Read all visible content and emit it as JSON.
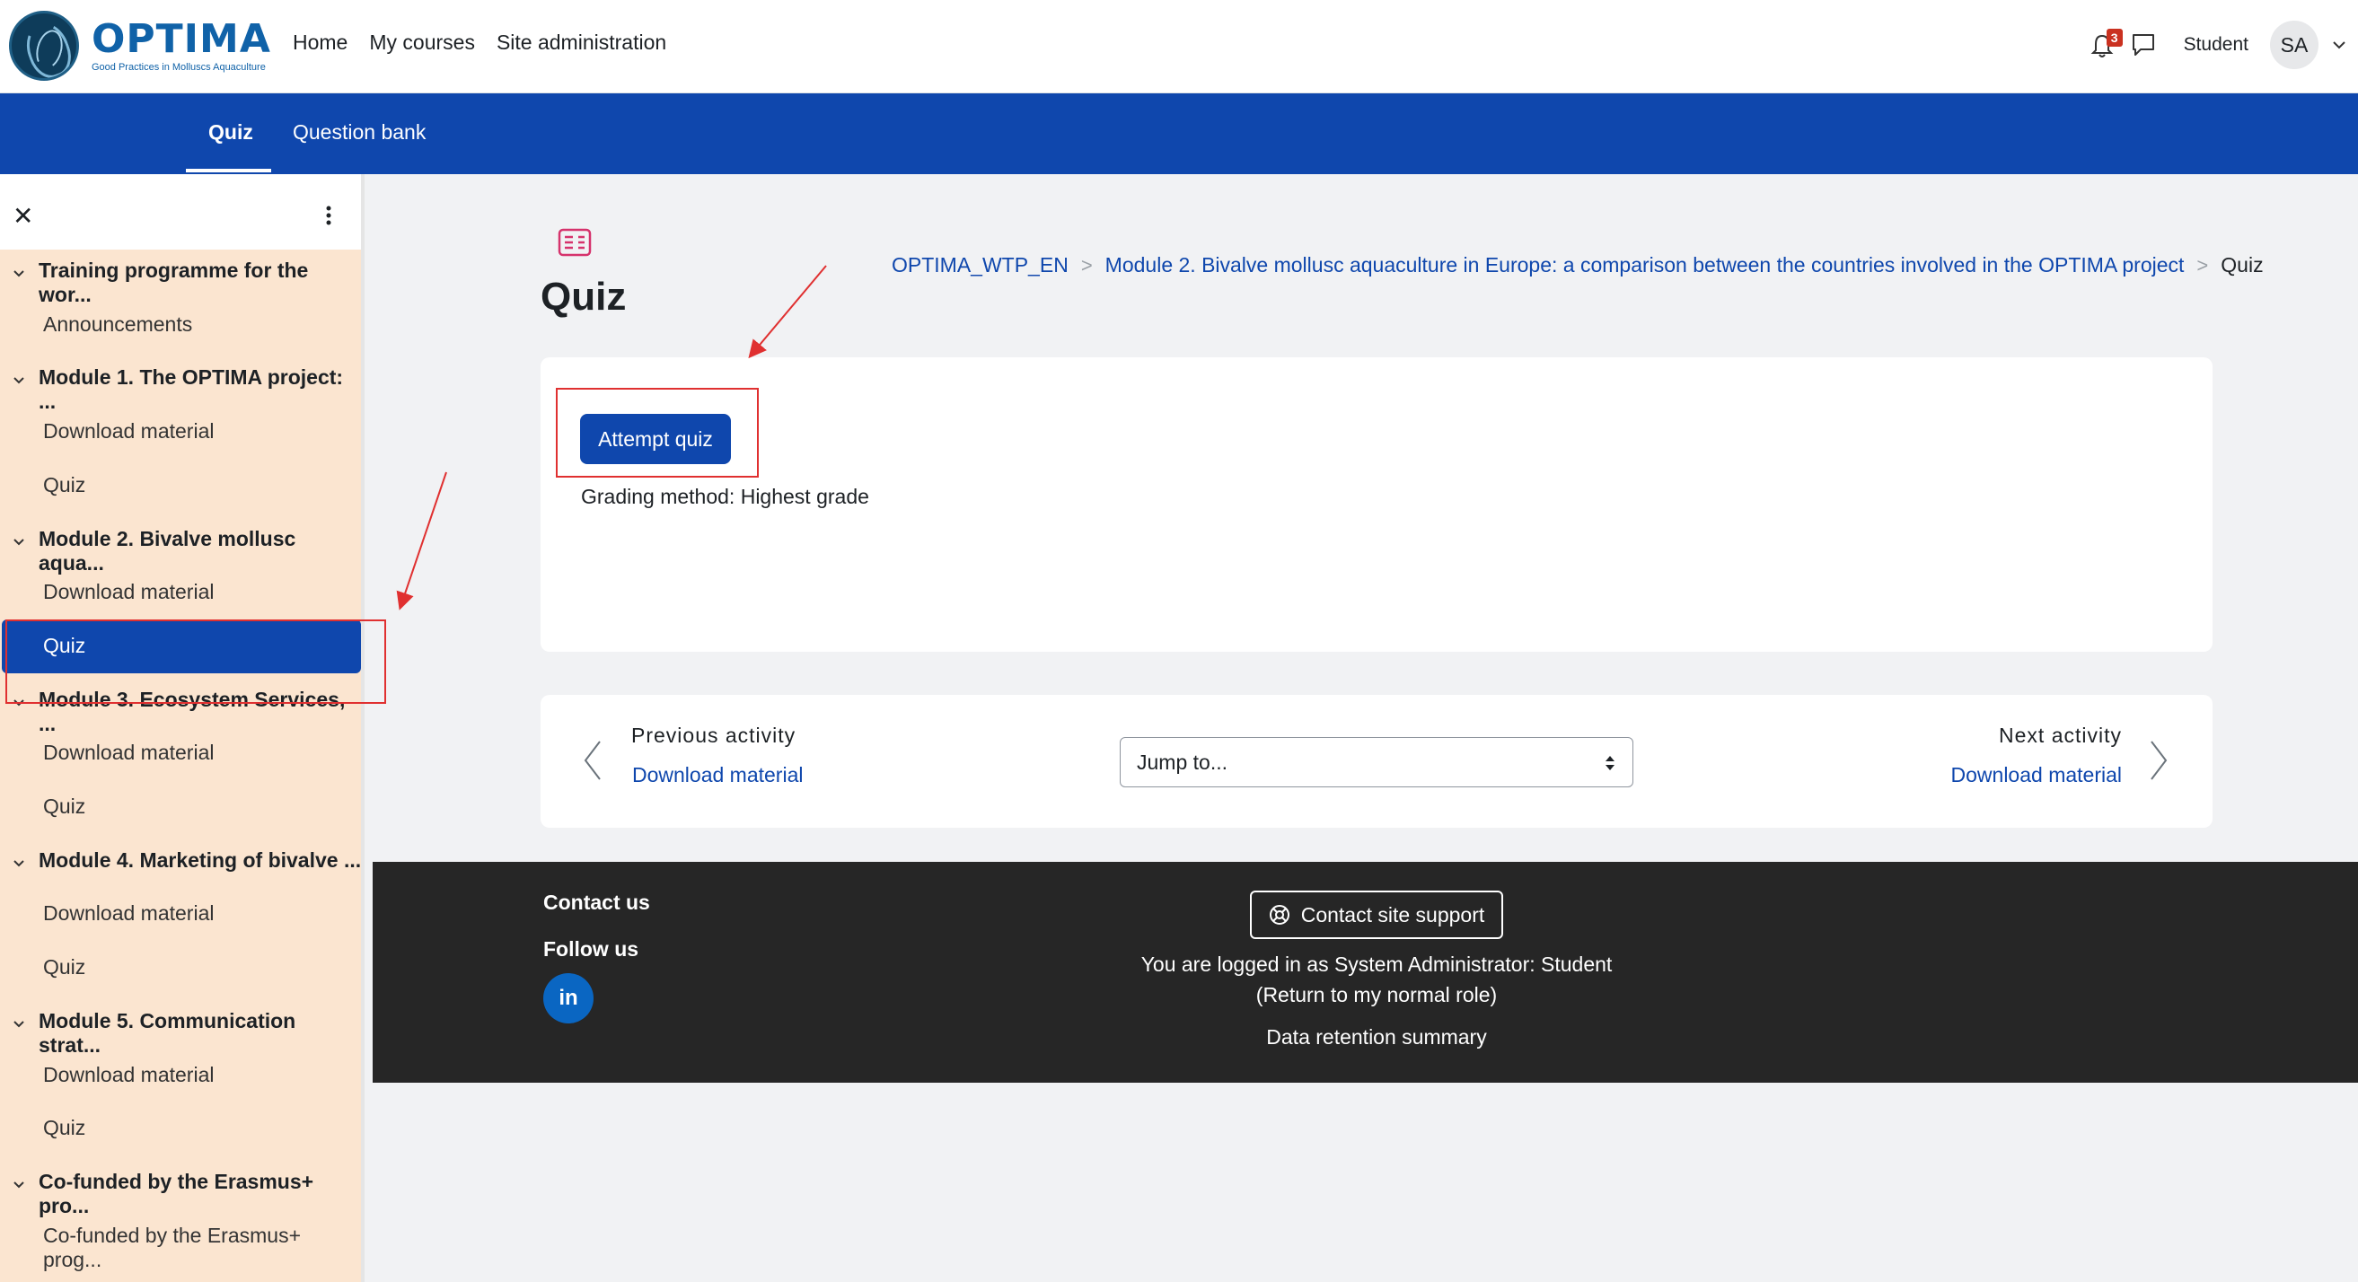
{
  "brand": {
    "title": "OPTIMA",
    "subtitle": "Good Practices in Molluscs Aquaculture"
  },
  "primary_nav": {
    "home": "Home",
    "my_courses": "My courses",
    "site_admin": "Site administration"
  },
  "user": {
    "notifications_count": "3",
    "name": "Student",
    "initials": "SA"
  },
  "secondary_nav": {
    "quiz": "Quiz",
    "question_bank": "Question bank"
  },
  "sidebar": {
    "items": [
      {
        "type": "section",
        "label": "Training programme for the wor..."
      },
      {
        "type": "link",
        "label": "Announcements"
      },
      {
        "type": "section",
        "label": "Module 1. The OPTIMA project: ..."
      },
      {
        "type": "link",
        "label": "Download material"
      },
      {
        "type": "link",
        "label": "Quiz"
      },
      {
        "type": "section",
        "label": "Module 2. Bivalve mollusc aqua..."
      },
      {
        "type": "link",
        "label": "Download material"
      },
      {
        "type": "active",
        "label": "Quiz"
      },
      {
        "type": "section",
        "label": "Module 3. Ecosystem Services, ..."
      },
      {
        "type": "link",
        "label": "Download material"
      },
      {
        "type": "link",
        "label": "Quiz"
      },
      {
        "type": "section",
        "label": "Module 4. Marketing of bivalve ..."
      },
      {
        "type": "link",
        "label": "Download material"
      },
      {
        "type": "link",
        "label": "Quiz"
      },
      {
        "type": "section",
        "label": "Module 5. Communication strat..."
      },
      {
        "type": "link",
        "label": "Download material"
      },
      {
        "type": "link",
        "label": "Quiz"
      },
      {
        "type": "section",
        "label": "Co-funded by the Erasmus+ pro..."
      },
      {
        "type": "link",
        "label": "Co-funded by the Erasmus+ prog..."
      }
    ]
  },
  "page": {
    "title": "Quiz",
    "breadcrumb": [
      "OPTIMA_WTP_EN",
      "Module 2. Bivalve mollusc aquaculture in Europe: a comparison between the countries involved in the OPTIMA project",
      "Quiz"
    ],
    "attempt_button": "Attempt quiz",
    "grading": "Grading method: Highest grade"
  },
  "activity_nav": {
    "prev_label": "Previous activity",
    "prev_link": "Download material",
    "jump_placeholder": "Jump to...",
    "next_label": "Next activity",
    "next_link": "Download material"
  },
  "footer": {
    "contact_us": "Contact us",
    "follow_us": "Follow us",
    "linkedin": "in",
    "support_button": "Contact site support",
    "logged_in": "You are logged in as System Administrator: Student",
    "return_role": "(Return to my normal role)",
    "data_retention": "Data retention summary"
  },
  "colors": {
    "primary": "#0f47ad",
    "sidebar_bg": "#fbe5d0",
    "footer_bg": "#262626",
    "annotation": "#e03030"
  }
}
